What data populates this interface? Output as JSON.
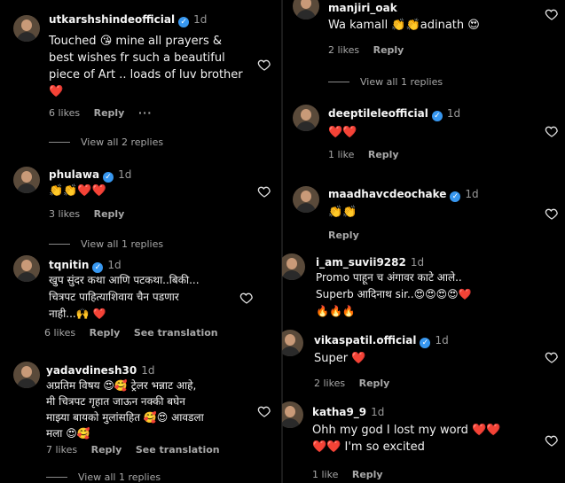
{
  "left": [
    {
      "username": "utkarshshindeofficial",
      "verified": true,
      "time": "1d",
      "text_lines": [
        "Touched 😘 mine all prayers &",
        "best wishes fr such a beautiful",
        "piece of Art .. loads of luv brother",
        "❤️"
      ],
      "likes": "6 likes",
      "reply": "Reply",
      "translation": "",
      "more": "···",
      "view_replies": "View all 2 replies"
    },
    {
      "username": "phulawa",
      "verified": true,
      "time": "1d",
      "text_lines": [
        "👏👏❤️❤️"
      ],
      "likes": "3 likes",
      "reply": "Reply",
      "translation": "",
      "more": "",
      "view_replies": "View all 1 replies"
    },
    {
      "username": "tqnitin",
      "verified": true,
      "time": "1d",
      "text_lines": [
        "खुप सुंदर कथा आणि पटकथा..बिकी...",
        "चित्रपट पाहित्याशिवाय चैन पडणार",
        "नाही...🙌 ❤️"
      ],
      "likes": "6 likes",
      "reply": "Reply",
      "translation": "See translation",
      "more": "",
      "view_replies": ""
    },
    {
      "username": "yadavdinesh30",
      "verified": false,
      "time": "1d",
      "text_lines": [
        "अप्रतिम विषय 😍🥰 ट्रेलर भन्नाट आहे,",
        "मी चित्रपट गृहात जाऊन नक्की बघेन",
        "माझ्या बायको मुलांसहित 🥰😍 आवडला",
        "मला 😍🥰"
      ],
      "likes": "7 likes",
      "reply": "Reply",
      "translation": "See translation",
      "more": "",
      "view_replies": "View all 1 replies"
    }
  ],
  "right": [
    {
      "username": "manjiri_oak",
      "verified": false,
      "time": "",
      "text_lines": [
        "Wa kamall 👏👏adinath 😍"
      ],
      "likes": "2 likes",
      "reply": "Reply",
      "translation": "",
      "more": "",
      "view_replies": "View all 1 replies"
    },
    {
      "username": "deeptileleofficial",
      "verified": true,
      "time": "1d",
      "text_lines": [
        "❤️❤️"
      ],
      "likes": "1 like",
      "reply": "Reply",
      "translation": "",
      "more": "",
      "view_replies": ""
    },
    {
      "username": "maadhavcdeochake",
      "verified": true,
      "time": "1d",
      "text_lines": [
        "👏👏"
      ],
      "likes": "",
      "reply": "Reply",
      "translation": "",
      "more": "",
      "view_replies": ""
    },
    {
      "username": "i_am_suvii9282",
      "verified": false,
      "time": "1d",
      "text_lines": [
        "Promo पाहून च अंगावर काटे आले..",
        "Superb आदिनाथ sir..😍😍😍😍❤️",
        "🔥🔥🔥"
      ],
      "likes": "",
      "reply": "",
      "translation": "",
      "more": "",
      "view_replies": ""
    },
    {
      "username": "vikaspatil.official",
      "verified": true,
      "time": "1d",
      "text_lines": [
        "Super ❤️"
      ],
      "likes": "2 likes",
      "reply": "Reply",
      "translation": "",
      "more": "",
      "view_replies": ""
    },
    {
      "username": "katha9_9",
      "verified": false,
      "time": "1d",
      "text_lines": [
        "Ohh my god I lost my word ❤️❤️",
        "❤️❤️ I'm so excited"
      ],
      "likes": "1 like",
      "reply": "Reply",
      "translation": "",
      "more": "",
      "view_replies": ""
    }
  ],
  "icons": {
    "heart": "heart-outline-icon",
    "verified": "verified-badge-icon"
  },
  "colors": {
    "background": "#000000",
    "verified_blue": "#3797f0",
    "muted": "#a8a8a8"
  }
}
